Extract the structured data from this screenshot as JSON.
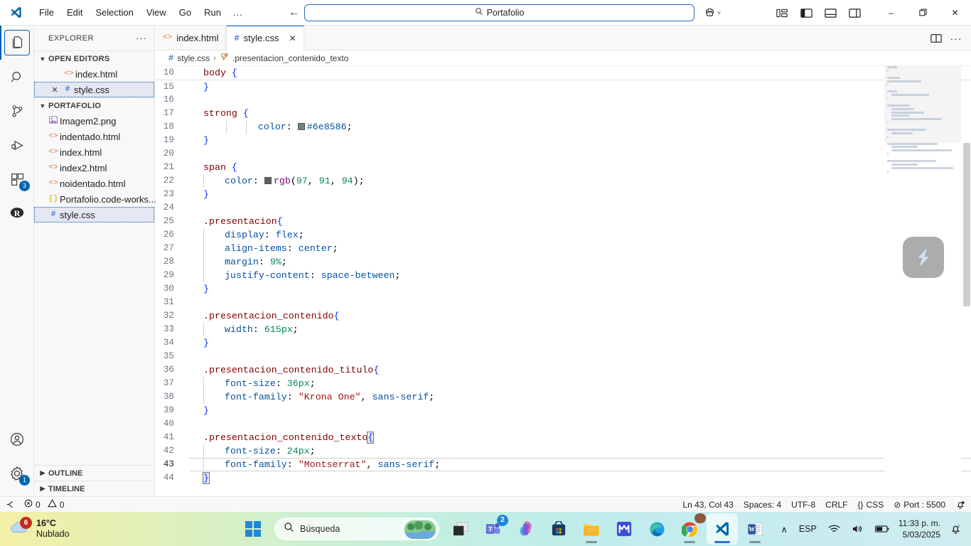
{
  "titlebar": {
    "app_icon": "vscode-logo",
    "menu": [
      "File",
      "Edit",
      "Selection",
      "View",
      "Go",
      "Run",
      "..."
    ],
    "nav_back": "back-arrow",
    "nav_forward": "forward-arrow",
    "search_value": "Portafolio",
    "search_icon": "search-icon",
    "accounts_icon": "remote-explorer-icon",
    "layout_icons": [
      "customize-layout-icon",
      "toggle-primary-sidebar-icon",
      "toggle-panel-icon",
      "toggle-secondary-sidebar-icon"
    ],
    "window_minimize": "–",
    "window_maximize": "❐",
    "window_close": "✕"
  },
  "activitybar": {
    "items": [
      {
        "name": "explorer",
        "icon": "files-icon",
        "badge": ""
      },
      {
        "name": "search",
        "icon": "search-icon",
        "badge": ""
      },
      {
        "name": "source-control",
        "icon": "source-control-icon",
        "badge": ""
      },
      {
        "name": "run-and-debug",
        "icon": "run-debug-icon",
        "badge": ""
      },
      {
        "name": "extensions",
        "icon": "extensions-icon",
        "badge": "3"
      },
      {
        "name": "r-extension",
        "icon": "r-language-icon",
        "badge": ""
      }
    ],
    "bottom": [
      {
        "name": "accounts",
        "icon": "account-icon",
        "badge": ""
      },
      {
        "name": "settings",
        "icon": "gear-icon",
        "badge": "1"
      }
    ]
  },
  "sidebar": {
    "title": "EXPLORER",
    "more_actions": "···",
    "open_editors": {
      "label": "OPEN EDITORS",
      "expanded": true,
      "items": [
        {
          "name": "index.html",
          "icon": "html-icon",
          "selected": false,
          "closeable": false
        },
        {
          "name": "style.css",
          "icon": "css-icon",
          "selected": true,
          "closeable": true
        }
      ]
    },
    "project": {
      "label": "PORTAFOLIO",
      "expanded": true,
      "items": [
        {
          "name": "Imagem2.png",
          "icon": "image-icon",
          "selected": false
        },
        {
          "name": "indentado.html",
          "icon": "html-icon",
          "selected": false
        },
        {
          "name": "index.html",
          "icon": "html-icon",
          "selected": false
        },
        {
          "name": "index2.html",
          "icon": "html-icon",
          "selected": false
        },
        {
          "name": "noidentado.html",
          "icon": "html-icon",
          "selected": false
        },
        {
          "name": "Portafolio.code-works...",
          "icon": "json-icon",
          "selected": false
        },
        {
          "name": "style.css",
          "icon": "css-icon",
          "selected": true
        }
      ]
    },
    "outline_label": "OUTLINE",
    "timeline_label": "TIMELINE"
  },
  "editor": {
    "tabs": [
      {
        "label": "index.html",
        "icon": "html-icon",
        "active": false,
        "closeable": false
      },
      {
        "label": "style.css",
        "icon": "css-icon",
        "active": true,
        "closeable": true
      }
    ],
    "tab_actions": [
      "split-editor-icon",
      "more-actions-icon"
    ],
    "breadcrumb": {
      "file_icon": "css-icon",
      "file": "style.css",
      "separator": "›",
      "symbol_icon": "css-symbol-icon",
      "symbol": ".presentacion_contenido_texto"
    },
    "overlay_button": "snippet-overlay-icon",
    "lines": [
      {
        "num": "10",
        "html": "<span class=\"tk-sel\">body</span> <span class=\"tk-brace\">{</span>"
      },
      {
        "num": "15",
        "html": "<span class=\"tk-brace\">}</span>",
        "foldedTop": true
      },
      {
        "num": "16",
        "html": ""
      },
      {
        "num": "17",
        "html": "<span class=\"tk-sel\">strong</span> <span class=\"tk-brace\">{</span>"
      },
      {
        "num": "18",
        "html": "    <span class=\"guide\"></span><span class=\"guide\" style=\"margin-left:27px\"></span>  <span class=\"tk-prop\">color</span><span class=\"tk-punc\">:</span> <span class=\"swatch\" style=\"background:#6e8586\"></span><span class=\"tk-hex\">#6e8586</span><span class=\"tk-punc\">;</span>",
        "raw": true
      },
      {
        "num": "19",
        "html": "<span class=\"tk-brace\">}</span>"
      },
      {
        "num": "20",
        "html": ""
      },
      {
        "num": "21",
        "html": "<span class=\"tk-sel\">span</span> <span class=\"tk-brace\">{</span>"
      },
      {
        "num": "22",
        "html": "<span class=\"tk-prop\">color</span><span class=\"tk-punc\">:</span> <span class=\"swatch\" style=\"background:rgb(97,91,94)\"></span><span class=\"tk-rgb\">rgb</span><span class=\"tk-punc\">(</span><span class=\"tk-num\">97</span><span class=\"tk-punc\">, </span><span class=\"tk-num\">91</span><span class=\"tk-punc\">, </span><span class=\"tk-num\">94</span><span class=\"tk-punc\">);</span>",
        "indent": 1
      },
      {
        "num": "23",
        "html": "<span class=\"tk-brace\">}</span>"
      },
      {
        "num": "24",
        "html": ""
      },
      {
        "num": "25",
        "html": "<span class=\"tk-sel\">.presentacion</span><span class=\"tk-brace\">{</span>"
      },
      {
        "num": "26",
        "html": "<span class=\"tk-prop\">display</span><span class=\"tk-punc\">:</span> <span class=\"tk-val\">flex</span><span class=\"tk-punc\">;</span>",
        "indent": 1
      },
      {
        "num": "27",
        "html": "<span class=\"tk-prop\">align-items</span><span class=\"tk-punc\">:</span> <span class=\"tk-val\">center</span><span class=\"tk-punc\">;</span>",
        "indent": 1
      },
      {
        "num": "28",
        "html": "<span class=\"tk-prop\">margin</span><span class=\"tk-punc\">:</span> <span class=\"tk-num\">9%</span><span class=\"tk-punc\">;</span>",
        "indent": 1
      },
      {
        "num": "29",
        "html": "<span class=\"tk-prop\">justify-content</span><span class=\"tk-punc\">:</span> <span class=\"tk-val\">space-between</span><span class=\"tk-punc\">;</span>",
        "indent": 1
      },
      {
        "num": "30",
        "html": "<span class=\"tk-brace\">}</span>"
      },
      {
        "num": "31",
        "html": ""
      },
      {
        "num": "32",
        "html": "<span class=\"tk-sel\">.presentacion_contenido</span><span class=\"tk-brace\">{</span>"
      },
      {
        "num": "33",
        "html": "<span class=\"tk-prop\">width</span><span class=\"tk-punc\">:</span> <span class=\"tk-num\">615px</span><span class=\"tk-punc\">;</span>",
        "indent": 1
      },
      {
        "num": "34",
        "html": "<span class=\"tk-brace\">}</span>"
      },
      {
        "num": "35",
        "html": ""
      },
      {
        "num": "36",
        "html": "<span class=\"tk-sel\">.presentacion_contenido_titulo</span><span class=\"tk-brace\">{</span>"
      },
      {
        "num": "37",
        "html": "<span class=\"tk-prop\">font-size</span><span class=\"tk-punc\">:</span> <span class=\"tk-num\">36px</span><span class=\"tk-punc\">;</span>",
        "indent": 1
      },
      {
        "num": "38",
        "html": "<span class=\"tk-prop\">font-family</span><span class=\"tk-punc\">:</span> <span class=\"tk-str\">\"Krona One\"</span><span class=\"tk-punc\">,</span> <span class=\"tk-val\">sans-serif</span><span class=\"tk-punc\">;</span>",
        "indent": 1
      },
      {
        "num": "39",
        "html": "<span class=\"tk-brace\">}</span>"
      },
      {
        "num": "40",
        "html": ""
      },
      {
        "num": "41",
        "html": "<span class=\"tk-sel\">.presentacion_contenido_texto</span><span class=\"tk-brace brace-match\">{</span>"
      },
      {
        "num": "42",
        "html": "<span class=\"tk-prop\">font-size</span><span class=\"tk-punc\">:</span> <span class=\"tk-num\">24px</span><span class=\"tk-punc\">;</span>",
        "indent": 1
      },
      {
        "num": "43",
        "html": "<span class=\"tk-prop\">font-family</span><span class=\"tk-punc\">:</span> <span class=\"tk-str\">\"Montserrat\"</span><span class=\"tk-punc\">,</span> <span class=\"tk-val\">sans-serif</span><span class=\"tk-punc\">;</span>",
        "indent": 1,
        "current": true
      },
      {
        "num": "44",
        "html": "<span class=\"tk-brace brace-match\">}</span>"
      }
    ]
  },
  "statusbar": {
    "remote_icon": "remote-window-icon",
    "errors_icon": "error-icon",
    "errors": "0",
    "warnings_icon": "warning-icon",
    "warnings": "0",
    "cursor_position": "Ln 43, Col 43",
    "indentation": "Spaces: 4",
    "encoding": "UTF-8",
    "eol": "CRLF",
    "language_icon": "{}",
    "language": "CSS",
    "live_server_icon": "⊘",
    "live_server": "Port : 5500",
    "bell_icon": "bell-dot-icon"
  },
  "taskbar": {
    "weather": {
      "temp": "16°C",
      "desc": "Nublado",
      "badge": "6",
      "icon": "cloud-icon"
    },
    "start_icon": "windows-start-icon",
    "search": {
      "placeholder": "Búsqueda",
      "icon": "search-icon"
    },
    "apps": [
      {
        "name": "task-view",
        "icon": "task-view-icon",
        "badge": "",
        "active": false,
        "running": false
      },
      {
        "name": "microsoft-teams",
        "icon": "teams-icon",
        "badge": "2",
        "active": false,
        "running": false
      },
      {
        "name": "copilot",
        "icon": "copilot-icon",
        "badge": "",
        "active": false,
        "running": false
      },
      {
        "name": "microsoft-store",
        "icon": "store-icon",
        "badge": "",
        "active": false,
        "running": false
      },
      {
        "name": "file-explorer",
        "icon": "folder-icon",
        "badge": "",
        "active": false,
        "running": true
      },
      {
        "name": "mega-app",
        "icon": "blue-app-icon",
        "badge": "",
        "active": false,
        "running": false
      },
      {
        "name": "microsoft-edge",
        "icon": "edge-icon",
        "badge": "",
        "active": false,
        "running": false
      },
      {
        "name": "google-chrome",
        "icon": "chrome-icon",
        "badge": "",
        "active": false,
        "running": true
      },
      {
        "name": "visual-studio-code",
        "icon": "vscode-icon",
        "badge": "",
        "active": true,
        "running": true
      },
      {
        "name": "microsoft-word",
        "icon": "word-icon",
        "badge": "",
        "active": false,
        "running": true
      }
    ],
    "tray": {
      "chevron": "∧",
      "language": "ESP",
      "wifi_icon": "wifi-icon",
      "volume_icon": "volume-icon",
      "battery_icon": "battery-icon",
      "time": "11:33 p. m.",
      "date": "5/03/2025",
      "notifications_icon": "bell-sleep-icon"
    }
  },
  "colors": {
    "accent": "#005fb8",
    "titlebar_bg": "#ffffff",
    "sidebar_bg": "#f8f8f8",
    "editor_bg": "#ffffff",
    "selection_bg": "#e4e6f1",
    "swatch_strong": "#6e8586",
    "swatch_span": "rgb(97, 91, 94)"
  }
}
